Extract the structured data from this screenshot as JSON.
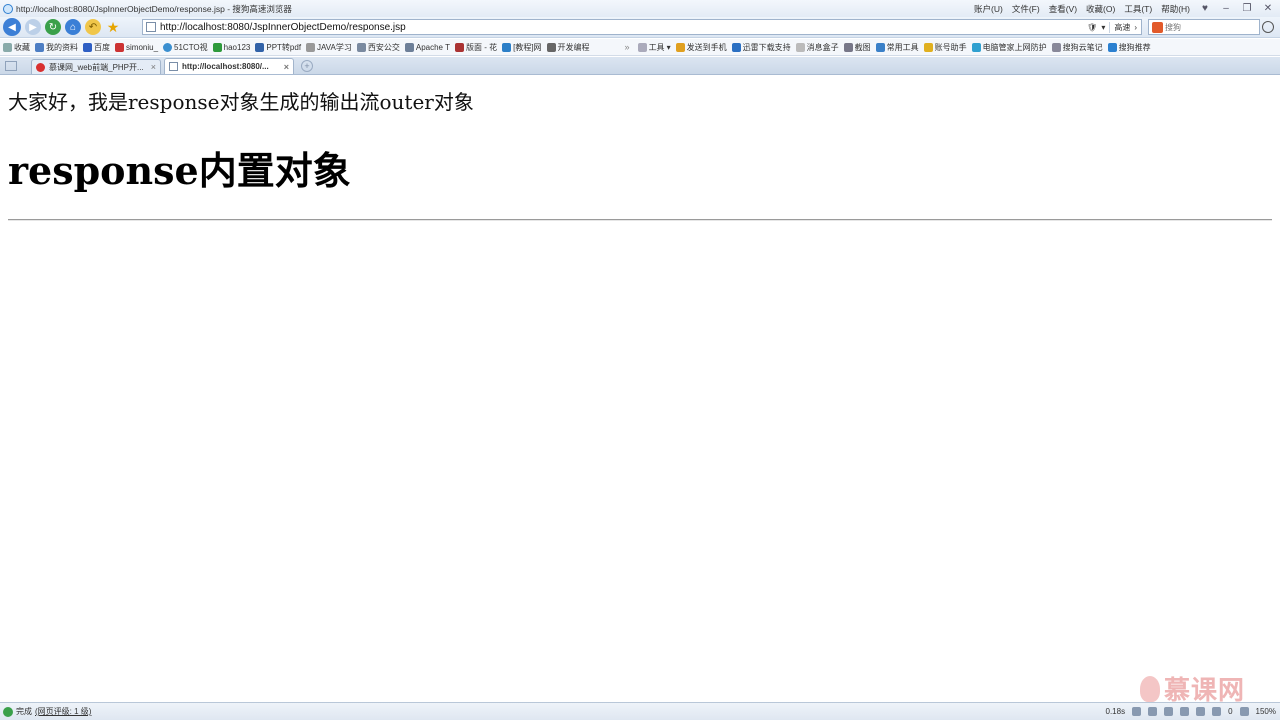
{
  "window": {
    "title": "http://localhost:8080/JspInnerObjectDemo/response.jsp - 搜狗高速浏览器",
    "menus": [
      "账户(U)",
      "文件(F)",
      "查看(V)",
      "收藏(O)",
      "工具(T)",
      "帮助(H)"
    ]
  },
  "nav": {
    "url": "http://localhost:8080/JspInnerObjectDemo/response.jsp",
    "speed_label": "高速",
    "search_placeholder": "搜狗"
  },
  "bookmarks": {
    "items": [
      "收藏",
      "我的资料",
      "百度",
      "simoniu_",
      "51CTO视",
      "hao123",
      "PPT转pdf",
      "JAVA学习",
      "西安公交",
      "Apache T",
      "版面 - 花",
      "[教程]网",
      "开发编程"
    ],
    "tools": [
      "工具",
      "发送到手机",
      "迅雷下载支持",
      "消息盒子",
      "截图",
      "常用工具",
      "账号助手",
      "电脑管家上网防护",
      "搜狗云笔记",
      "搜狗推荐"
    ],
    "more": "»"
  },
  "tabs": [
    {
      "label": "慕课网_web前端_PHP开...",
      "active": false
    },
    {
      "label": "http://localhost:8080/...",
      "active": true
    }
  ],
  "page": {
    "output_text": "大家好，我是response对象生成的输出流outer对象",
    "heading": "response内置对象"
  },
  "watermark": {
    "text": "慕课网"
  },
  "status": {
    "done": "完成",
    "rating": "(网页评级: 1 级)",
    "load_time": "0.18s",
    "counter": "0",
    "zoom": "150%"
  },
  "colors": {
    "accent": "#3c7fd6",
    "refresh": "#3aa04a",
    "watermark": "#efb5b5"
  }
}
